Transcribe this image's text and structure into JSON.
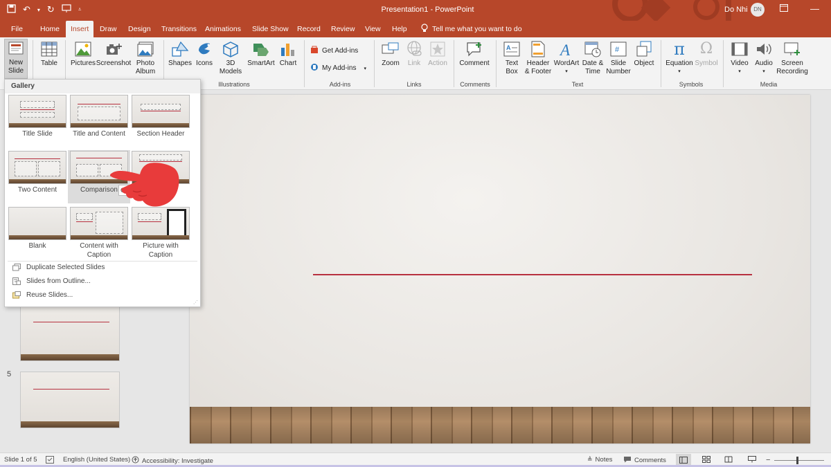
{
  "titlebar": {
    "title": "Presentation1  -  PowerPoint",
    "user_name": "Do Nhi",
    "user_initials": "DN"
  },
  "tabs": [
    "File",
    "Home",
    "Insert",
    "Draw",
    "Design",
    "Transitions",
    "Animations",
    "Slide Show",
    "Record",
    "Review",
    "View",
    "Help"
  ],
  "active_tab": "Insert",
  "tell_me": "Tell me what you want to do",
  "ribbon": {
    "new_slide": [
      "New",
      "Slide"
    ],
    "table": "Table",
    "pictures": "Pictures",
    "screenshot": "Screenshot",
    "photo_album": [
      "Photo",
      "Album"
    ],
    "shapes": "Shapes",
    "icons": "Icons",
    "models_3d": [
      "3D",
      "Models"
    ],
    "smartart": "SmartArt",
    "chart": "Chart",
    "get_addins": "Get Add-ins",
    "my_addins": "My Add-ins",
    "zoom": "Zoom",
    "link": "Link",
    "action": "Action",
    "comment": "Comment",
    "text_box": [
      "Text",
      "Box"
    ],
    "header_footer": [
      "Header",
      "& Footer"
    ],
    "wordart": "WordArt",
    "date_time": [
      "Date &",
      "Time"
    ],
    "slide_number": [
      "Slide",
      "Number"
    ],
    "object": "Object",
    "equation": "Equation",
    "symbol": "Symbol",
    "video": "Video",
    "audio": "Audio",
    "screen_recording": [
      "Screen",
      "Recording"
    ],
    "groups": {
      "illustrations": "Illustrations",
      "addins": "Add-ins",
      "links": "Links",
      "comments": "Comments",
      "text": "Text",
      "symbols": "Symbols",
      "media": "Media"
    }
  },
  "gallery": {
    "header": "Gallery",
    "layouts": [
      "Title Slide",
      "Title and Content",
      "Section Header",
      "Two Content",
      "Comparison",
      "Blank",
      "Content with Caption",
      "Picture with Caption"
    ],
    "menu": [
      "Duplicate Selected Slides",
      "Slides from Outline...",
      "Reuse Slides..."
    ],
    "tooltip": "Comparison"
  },
  "slide_numbers": [
    "5"
  ],
  "statusbar": {
    "slide_info": "Slide 1 of 5",
    "language": "English (United States)",
    "accessibility": "Accessibility: Investigate",
    "notes": "Notes",
    "comments": "Comments"
  },
  "colors": {
    "accent": "#b7472a",
    "slide_line": "#b7303f"
  }
}
